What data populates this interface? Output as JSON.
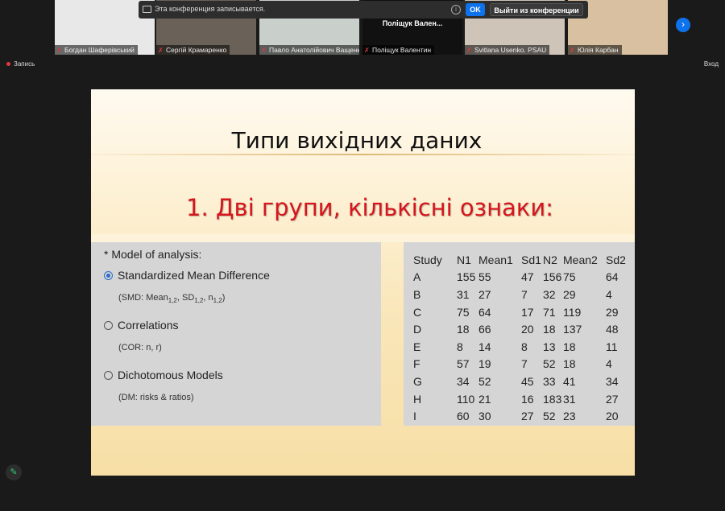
{
  "top_banner": {
    "recording_text": "Эта конференция записывается.",
    "ok_label": "OK",
    "exit_label": "Выйти из конференции"
  },
  "participants": [
    {
      "name": "Богдан Шаферівський",
      "bg": "#e8e8e8"
    },
    {
      "name": "Сергій Крамаренко",
      "bg": "#6a6258"
    },
    {
      "name": "Павло Анатолійович Ващенко",
      "bg": "#c9cfca"
    },
    {
      "name": "Поліщук Валентин",
      "big": "Поліщук Вален...",
      "bg": "#111111"
    },
    {
      "name": "Svitlana Usenko. PSAU",
      "bg": "#cfc4b8"
    },
    {
      "name": "Юлія Карбан",
      "bg": "#d8c0a0"
    }
  ],
  "status": {
    "recording_label": "Запись",
    "enter_label": "Вход"
  },
  "slide": {
    "title": "Типи вихідних даних",
    "subtitle": "1. Дві групи, кількісні ознаки:",
    "model_header": "* Model of analysis:",
    "options": [
      {
        "label": "Standardized Mean Difference",
        "selected": true
      },
      {
        "label": "Correlations",
        "sub": "(COR: n, r)",
        "selected": false
      },
      {
        "label": "Dichotomous Models",
        "sub": "(DM: risks & ratios)",
        "selected": false
      }
    ],
    "smd_sub": {
      "a": "(SMD: Mean",
      "s1": "1,2",
      "b": ", SD",
      "s2": "1,2",
      "c": ", n",
      "s3": "1,2",
      "d": ")"
    },
    "table": {
      "headers": [
        "Study",
        "N1",
        "Mean1",
        "Sd1",
        "N2",
        "Mean2",
        "Sd2"
      ],
      "rows": [
        [
          "A",
          "155",
          "55",
          "47",
          "156",
          "75",
          "64"
        ],
        [
          "B",
          "31",
          "27",
          "7",
          "32",
          "29",
          "4"
        ],
        [
          "C",
          "75",
          "64",
          "17",
          "71",
          "119",
          "29"
        ],
        [
          "D",
          "18",
          "66",
          "20",
          "18",
          "137",
          "48"
        ],
        [
          "E",
          "8",
          "14",
          "8",
          "13",
          "18",
          "11"
        ],
        [
          "F",
          "57",
          "19",
          "7",
          "52",
          "18",
          "4"
        ],
        [
          "G",
          "34",
          "52",
          "45",
          "33",
          "41",
          "34"
        ],
        [
          "H",
          "110",
          "21",
          "16",
          "183",
          "31",
          "27"
        ],
        [
          "I",
          "60",
          "30",
          "27",
          "52",
          "23",
          "20"
        ]
      ]
    }
  },
  "colors": {
    "accent": "#0e72ed",
    "title_red": "#d6151c",
    "mute_red": "#e0393e"
  }
}
